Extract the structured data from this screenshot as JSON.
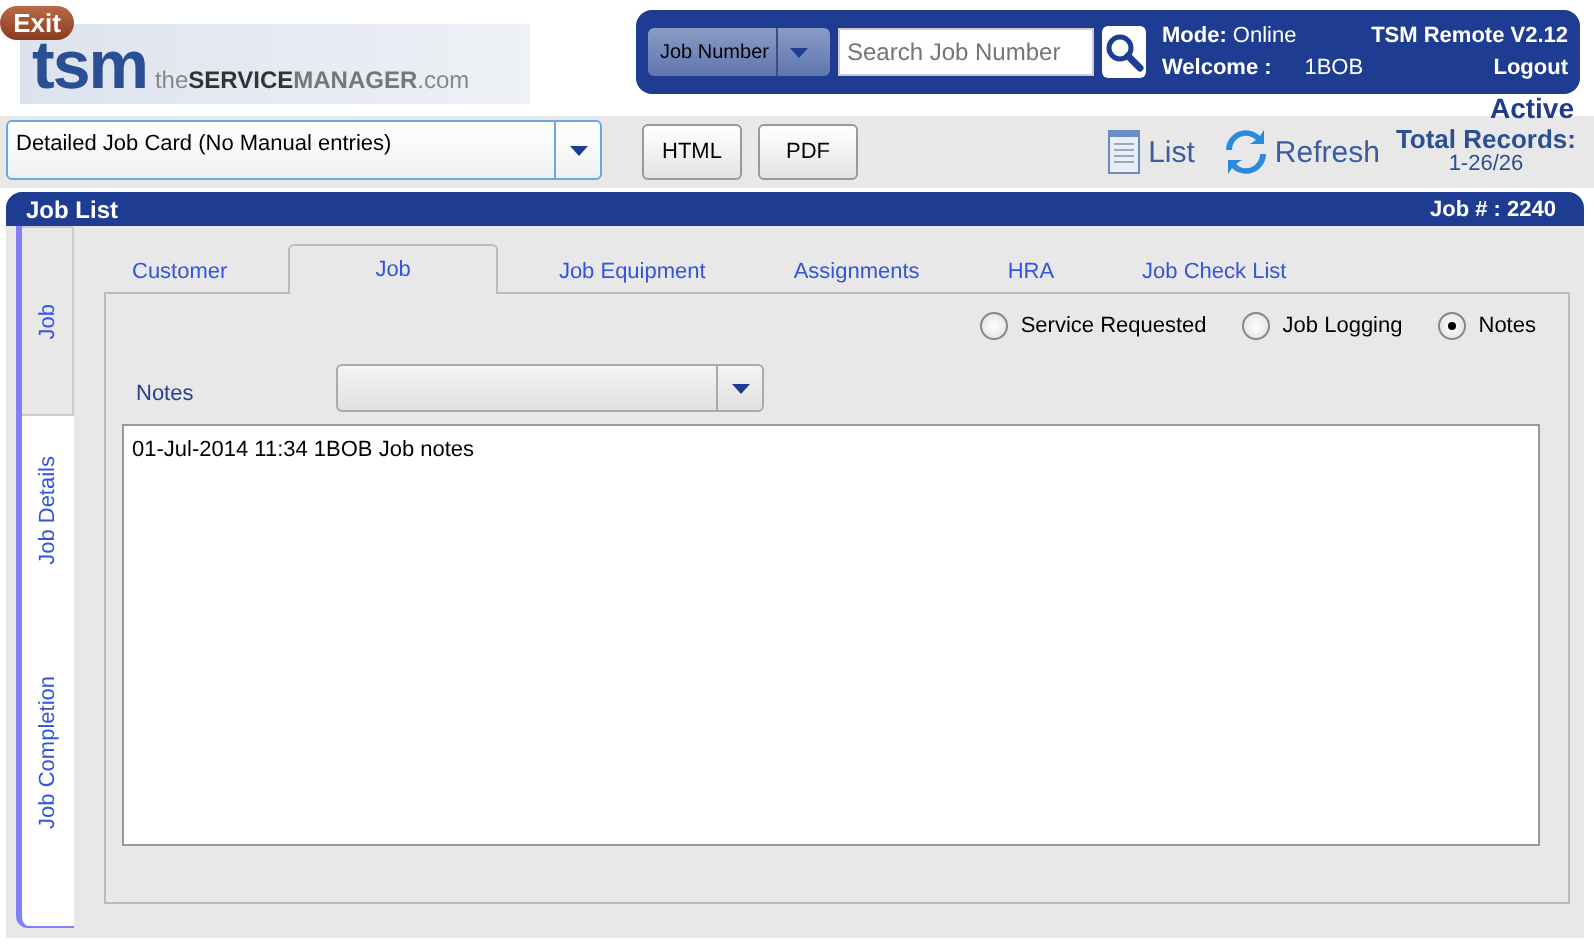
{
  "exit": "Exit",
  "logo": {
    "mark": "tsm",
    "tagline": [
      {
        "text": "the",
        "kind": "light"
      },
      {
        "text": "SERVICE",
        "kind": "bold"
      },
      {
        "text": "MANAGER",
        "kind": "medium"
      },
      {
        "text": ".com",
        "kind": "light"
      }
    ]
  },
  "header": {
    "search_type": "Job Number",
    "search": {
      "placeholder": "Search Job Number"
    },
    "mode_label": "Mode:",
    "mode": "Online",
    "version": "TSM Remote V2.12",
    "welcome_label": "Welcome :",
    "user": "1BOB",
    "logout": "Logout"
  },
  "status": "Active",
  "toolbar": {
    "report": "Detailed Job Card (No Manual entries)",
    "buttons": [
      "HTML",
      "PDF"
    ],
    "list": "List",
    "refresh": "Refresh",
    "total_label": "Total Records:",
    "total": "1-26/26"
  },
  "panel": {
    "title": "Job List",
    "job_number": "Job # : 2240",
    "side_tabs": [
      {
        "label": "Job",
        "selected": true
      },
      {
        "label": "Job Details",
        "selected": false
      },
      {
        "label": "Job Completion",
        "selected": false
      }
    ],
    "tabs": [
      {
        "label": "Customer",
        "selected": false
      },
      {
        "label": "Job",
        "selected": true
      },
      {
        "label": "Job Equipment",
        "selected": false
      },
      {
        "label": "Assignments",
        "selected": false
      },
      {
        "label": "HRA",
        "selected": false
      },
      {
        "label": "Job Check List",
        "selected": false
      }
    ],
    "radios": [
      {
        "label": "Service Requested",
        "selected": false
      },
      {
        "label": "Job Logging",
        "selected": false
      },
      {
        "label": "Notes",
        "selected": true
      }
    ],
    "notes_label": "Notes",
    "notes_text": "01-Jul-2014 11:34 1BOB Job notes"
  }
}
